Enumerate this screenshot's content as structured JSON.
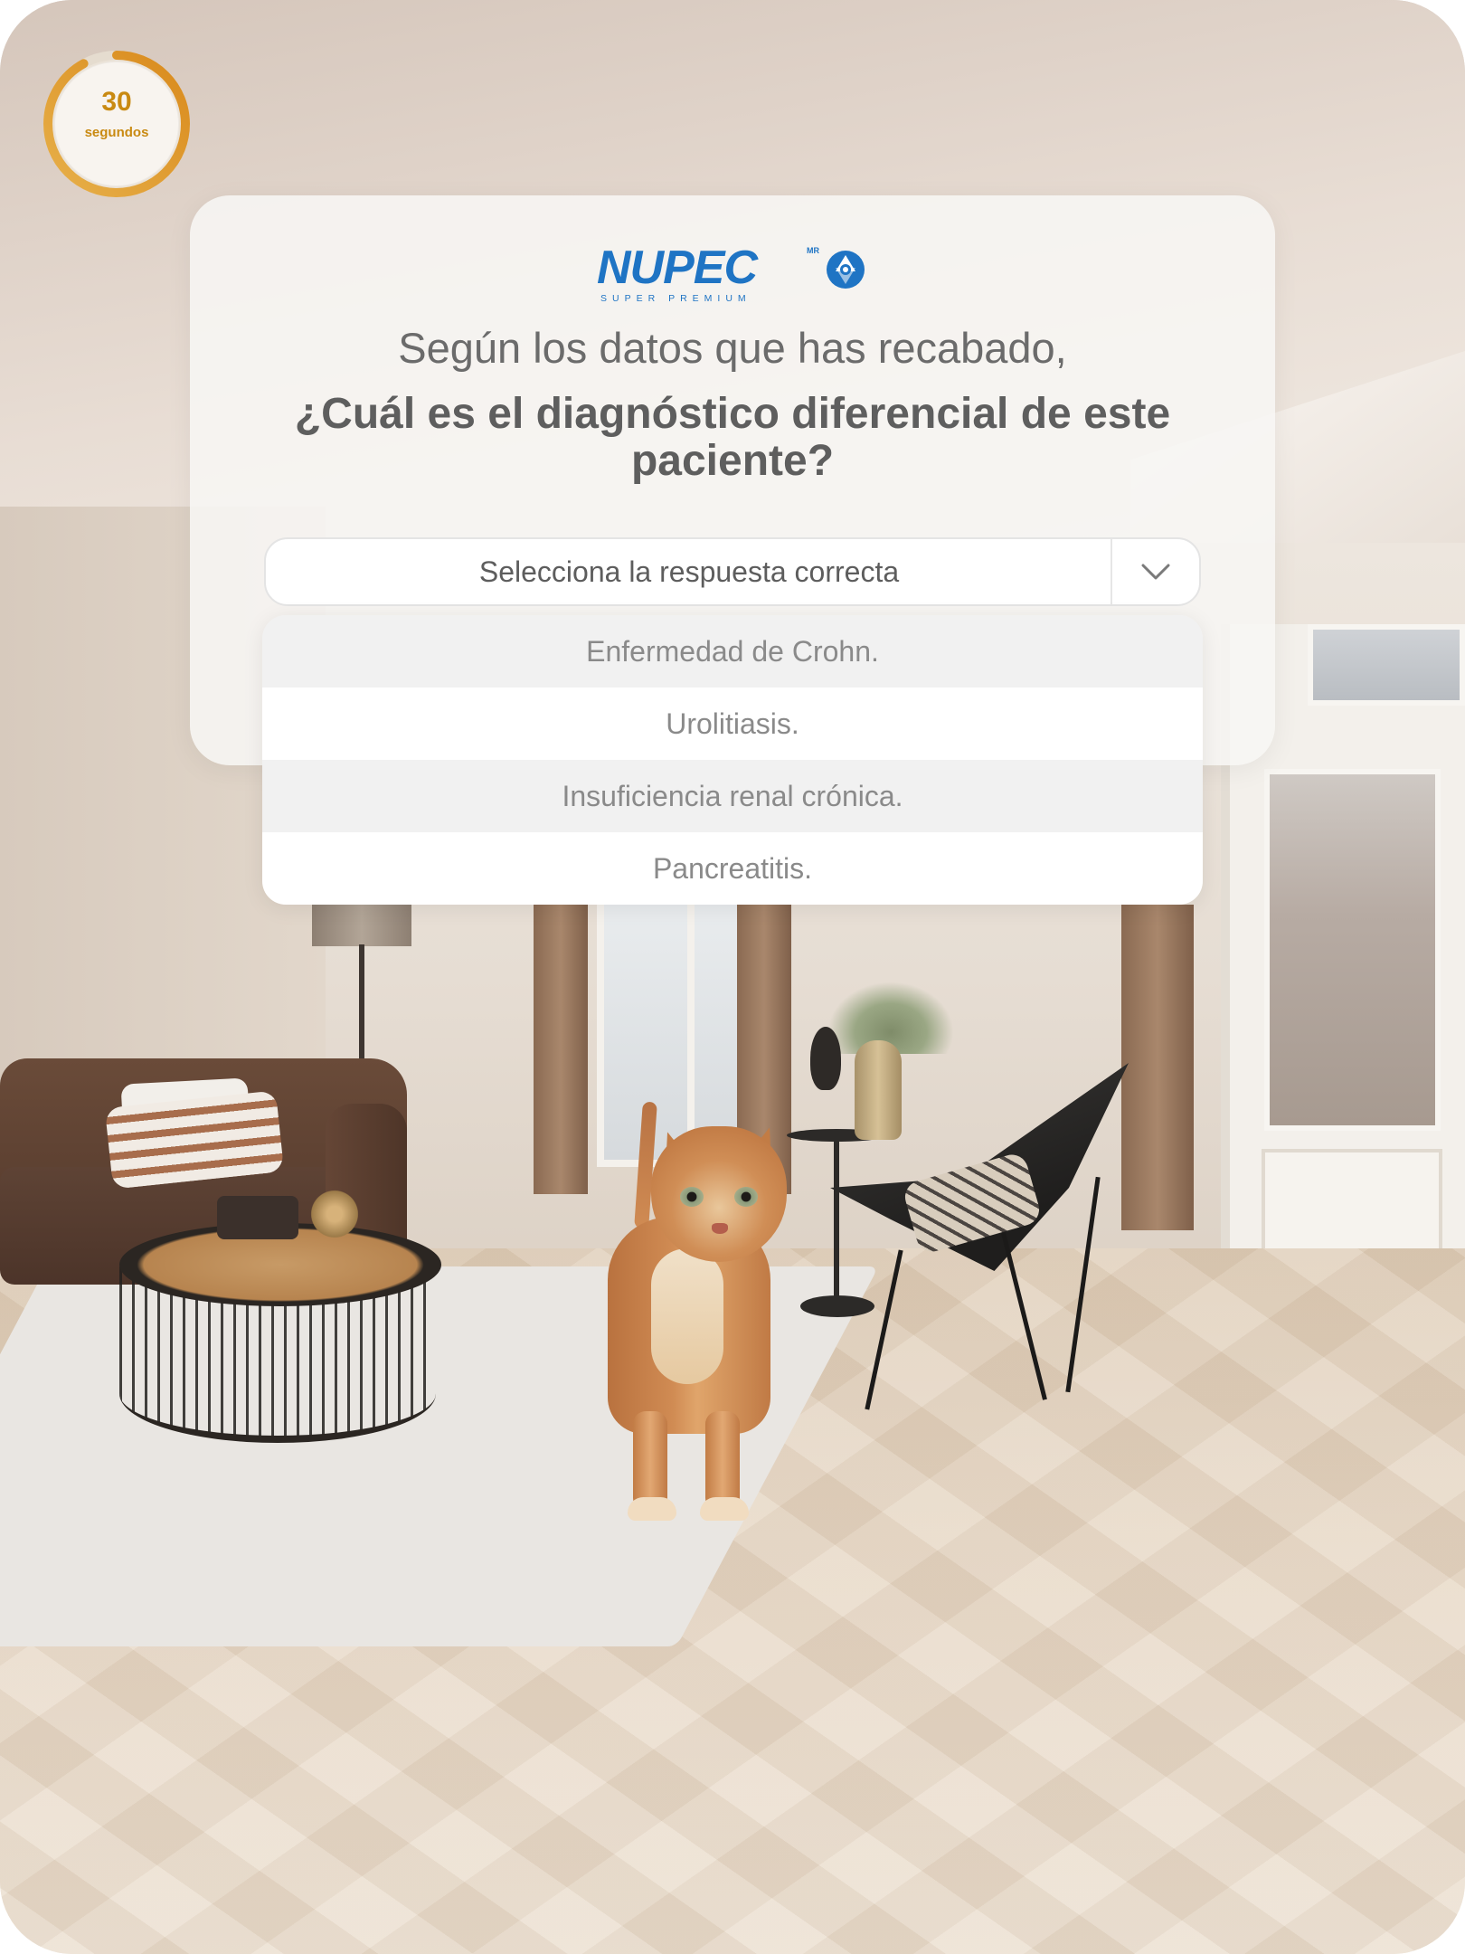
{
  "timer": {
    "value": "30",
    "unit": "segundos",
    "remaining_fraction": 0.92,
    "color": "#c98a12"
  },
  "brand": {
    "name": "NUPEC",
    "registered": "MR",
    "tagline": "SUPER PREMIUM",
    "color": "#1f74c4"
  },
  "question": {
    "lead": "Según los datos que has recabado,",
    "main": "¿Cuál es el diagnóstico diferencial de este paciente?"
  },
  "select": {
    "placeholder": "Selecciona la respuesta correcta",
    "options": [
      "Enfermedad de Crohn.",
      "Urolitiasis.",
      "Insuficiencia renal crónica.",
      "Pancreatitis."
    ]
  },
  "icons": {
    "dropdown": "chevron-down-icon",
    "logo": "nupec-emblem-icon"
  }
}
